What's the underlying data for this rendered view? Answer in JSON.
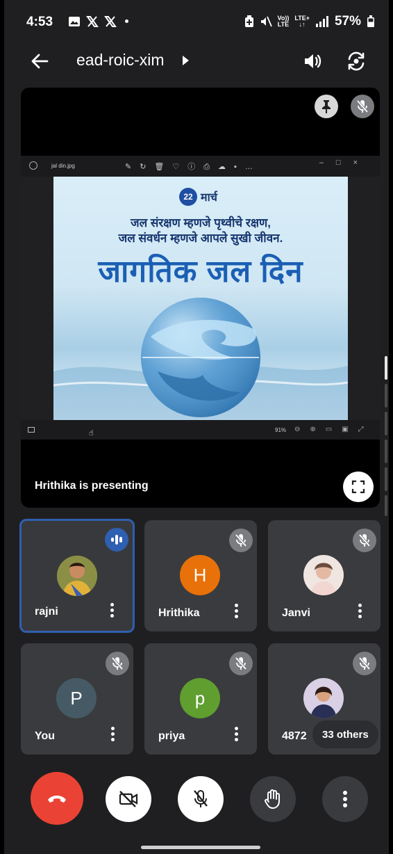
{
  "status_bar": {
    "time": "4:53",
    "network_top": "Vo))",
    "network_bottom": "LTE",
    "network2_top": "LTE+",
    "network2_bottom": "↓↑",
    "battery": "57%"
  },
  "topbar": {
    "meeting_code": "ead-roic-xim"
  },
  "presentation": {
    "file_name": "jal din.jpg",
    "zoom_level": "91%",
    "poster": {
      "date_number": "22",
      "date_month": "मार्च",
      "line1": "जल संरक्षण म्हणजे पृथ्वीचे रक्षण,",
      "line2": "जल संवर्धन म्हणजे आपले सुखी जीवन.",
      "headline": "जागतिक जल दिन"
    },
    "presenting_label": "Hrithika is presenting"
  },
  "participants": [
    {
      "name": "rajni",
      "avatar_type": "photo",
      "speaking": true
    },
    {
      "name": "Hrithika",
      "avatar_letter": "H",
      "avatar_color": "#e8710a",
      "muted": true
    },
    {
      "name": "Janvi",
      "avatar_type": "photo",
      "muted": true
    },
    {
      "name": "You",
      "avatar_letter": "P",
      "avatar_color": "#455a64",
      "muted": true
    },
    {
      "name": "priya",
      "avatar_letter": "p",
      "avatar_color": "#5f9e2f",
      "muted": true
    },
    {
      "name": "4872",
      "avatar_type": "photo",
      "muted": true,
      "others_label": "33 others"
    }
  ],
  "controls": {
    "end_call_color": "#ea4335",
    "icons": [
      "end-call-icon",
      "camera-off-icon",
      "mic-off-icon",
      "raise-hand-icon",
      "more-vert-icon"
    ]
  }
}
